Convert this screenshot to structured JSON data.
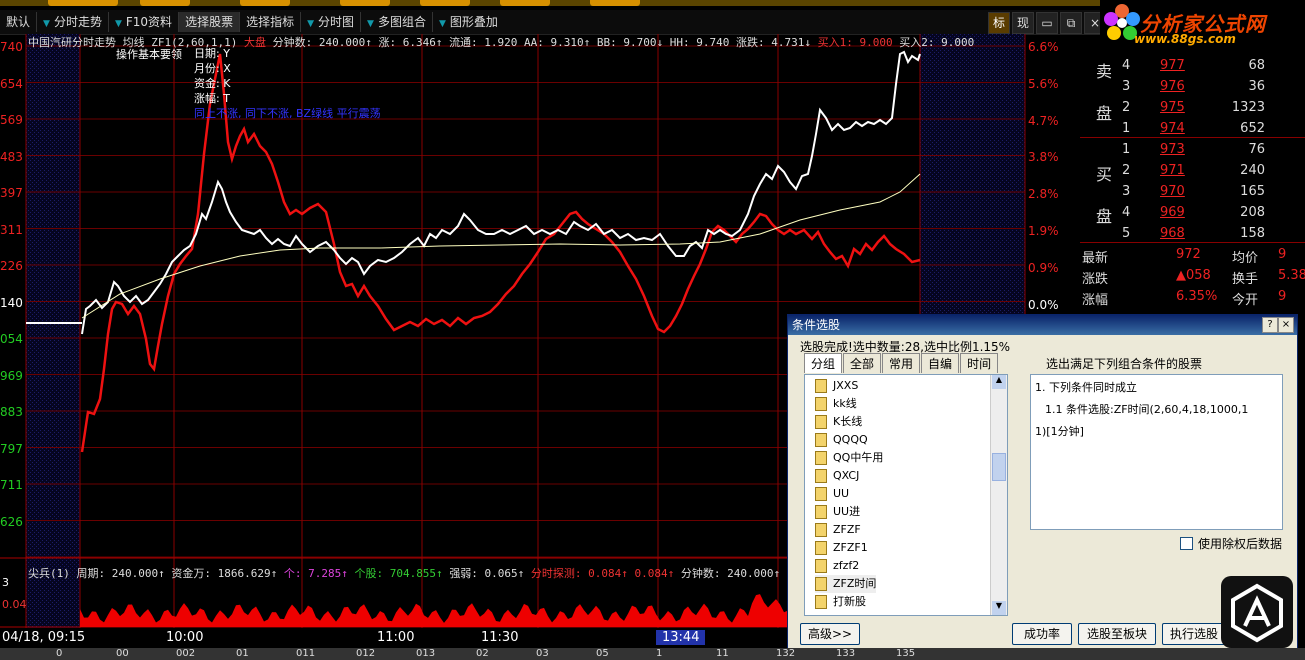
{
  "toolbar": {
    "items": [
      "默认",
      "分时走势",
      "F10资料",
      "选择股票",
      "选择指标",
      "分时图",
      "多图组合",
      "图形叠加"
    ],
    "right": [
      "标",
      "现"
    ]
  },
  "logo": {
    "name": "分析家公式网",
    "url": "www.88gs.com"
  },
  "infobar": {
    "title": "中国汽研分时走势",
    "indicator": "均线 ZF1(2,60,1,1)",
    "dapan": "大盘",
    "minutes": "分钟数: 240.000↑",
    "zhang": "涨: 6.346↑",
    "liutong": "流通: 1.920",
    "aa": "AA: 9.310↑",
    "bb": "BB: 9.700↓",
    "hh": "HH: 9.740",
    "zhangdie": "涨跌: 4.731↓",
    "mairu1": "买入1: 9.000",
    "mairu2": "买入2: 9.000"
  },
  "ops": {
    "title": "操作基本要领",
    "lines": [
      "日期: Y",
      "月份: X",
      "资金: K",
      "涨幅: T"
    ],
    "blue": "同上不涨, 同下不涨, BZ绿线    平行震荡"
  },
  "yaxis_left": [
    "740",
    "654",
    "569",
    "483",
    "397",
    "311",
    "226",
    "140",
    "054",
    "969",
    "883",
    "797",
    "711",
    "626"
  ],
  "yaxis_right": [
    "6.6%",
    "5.6%",
    "4.7%",
    "3.8%",
    "2.8%",
    "1.9%",
    "0.9%",
    "0.0%"
  ],
  "lower_info": {
    "name": "尖兵(1)",
    "period": "周期: 240.000↑",
    "fund": "资金万: 1866.629↑",
    "ge": "个: 7.285↑",
    "gegu": "个股: 704.855↑",
    "qiangruo": "强弱: 0.065↑",
    "tance": "分时探测: 0.084↑",
    "val": "0.084↑",
    "minutes": "分钟数: 240.000↑",
    "left1": "3",
    "left2": "0.04"
  },
  "time_axis": {
    "date": "04/18, 09:15",
    "labels": [
      "10:00",
      "11:00",
      "11:30",
      "13:44"
    ]
  },
  "orderbook": {
    "sell_label": [
      "卖",
      "盘"
    ],
    "buy_label": [
      "买",
      "盘"
    ],
    "sell": [
      [
        "4",
        "977",
        "68"
      ],
      [
        "3",
        "976",
        "36"
      ],
      [
        "2",
        "975",
        "1323"
      ],
      [
        "1",
        "974",
        "652"
      ]
    ],
    "buy": [
      [
        "1",
        "973",
        "76"
      ],
      [
        "2",
        "971",
        "240"
      ],
      [
        "3",
        "970",
        "165"
      ],
      [
        "4",
        "969",
        "208"
      ],
      [
        "5",
        "968",
        "158"
      ]
    ]
  },
  "quote": [
    [
      "最新",
      "972",
      "均价",
      "9"
    ],
    [
      "涨跌",
      "▲058",
      "换手",
      "5.38"
    ],
    [
      "涨幅",
      "6.35%",
      "今开",
      "9"
    ]
  ],
  "dialog": {
    "title": "条件选股",
    "status": "选股完成!选中数量:28,选中比例1.15%",
    "tabs": [
      "分组",
      "全部",
      "常用",
      "自编",
      "时间"
    ],
    "right_heading": "选出满足下列组合条件的股票",
    "tree": [
      "JXXS",
      "kk线",
      "K长线",
      "QQQQ",
      "QQ中午用",
      "QXCJ",
      "UU",
      "UU进",
      "ZFZF",
      "ZFZF1",
      "zfzf2",
      "ZFZ时间",
      "打新股"
    ],
    "cond1": "1. 下列条件同时成立",
    "cond2": "1.1  条件选股:ZF时间(2,60,4,18,1000,1",
    "cond3": "1)[1分钟]",
    "checkbox": "使用除权后数据",
    "buttons": [
      "高级>>",
      "成功率",
      "选股至板块",
      "执行选股"
    ]
  },
  "bottombar": [
    "0",
    "00",
    "002",
    "01",
    "011",
    "012",
    "013",
    "02",
    "03",
    "05",
    "1",
    "11",
    "132",
    "133",
    "135"
  ]
}
